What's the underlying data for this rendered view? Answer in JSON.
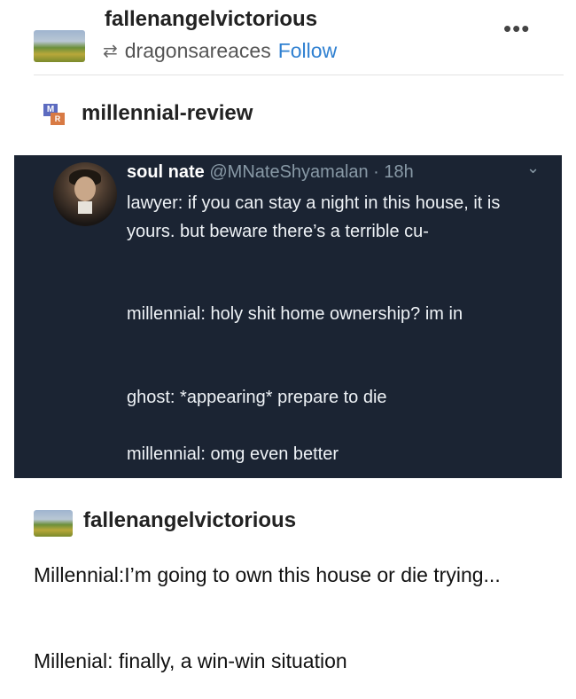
{
  "post": {
    "author": "fallenangelvictorious",
    "reblog_source": "dragonsareaces",
    "follow_label": "Follow",
    "more_label": "•••"
  },
  "reblog": {
    "blog_name": "millennial-review"
  },
  "tweet": {
    "display_name": "soul nate",
    "meta": "@MNateShyamalan · 18h",
    "lines": [
      "lawyer: if you can stay a night in this house, it is yours. but beware there’s a terrible cu-",
      "millennial: holy shit home ownership? im in",
      "ghost: *appearing* prepare to die",
      "millennial: omg even better"
    ],
    "bg_color": "#1b2433"
  },
  "reply": {
    "author": "fallenangelvictorious",
    "paragraphs": [
      "Millennial:I’m going to own this house or die trying...",
      "Millenial: finally, a win-win situation"
    ]
  },
  "colors": {
    "follow": "#2f80d1"
  },
  "icons": [
    "reblog-icon",
    "more-icon",
    "chevron-down-icon"
  ]
}
